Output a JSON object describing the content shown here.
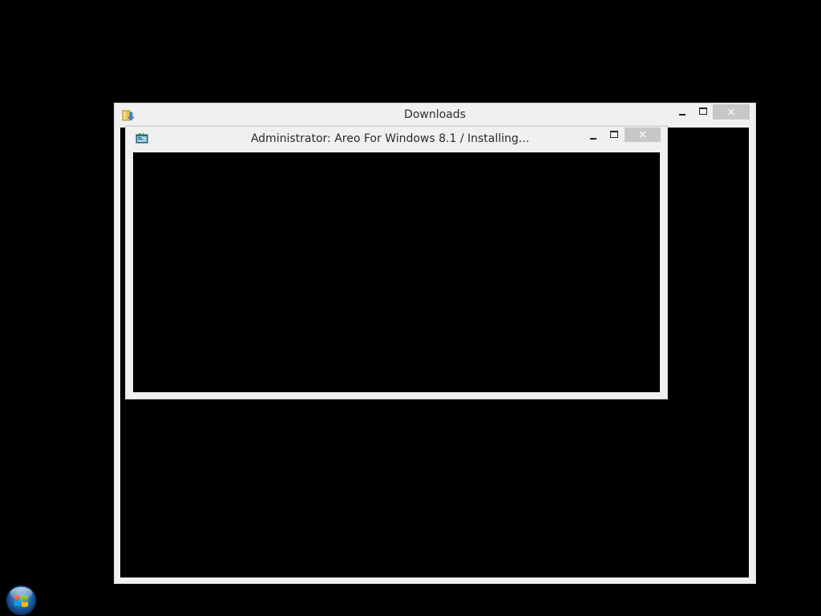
{
  "windows": {
    "downloads": {
      "title": "Downloads",
      "icon": "folder-download-icon",
      "controls": {
        "minimize": "minimize",
        "maximize": "maximize",
        "close": "×"
      }
    },
    "admin": {
      "title": "Administrator:  Areo For Windows 8.1 / Installing...",
      "icon": "console-icon",
      "controls": {
        "minimize": "minimize",
        "maximize": "maximize",
        "close": "×"
      }
    }
  },
  "taskbar": {
    "start_icon": "windows-start-orb-icon"
  },
  "colors": {
    "desktop_background": "#000000",
    "window_frame": "#f0f0f0",
    "close_button": "#c7c7c7",
    "title_text": "#2b2b2b",
    "client_area": "#000000"
  }
}
